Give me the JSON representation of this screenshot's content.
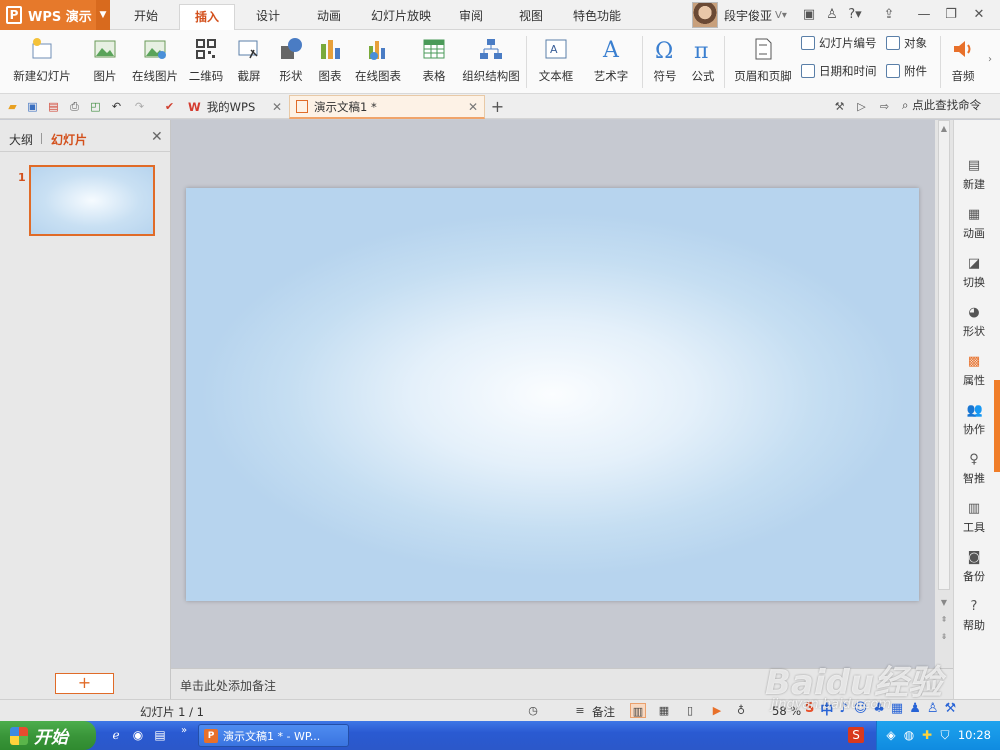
{
  "app": {
    "name": "WPS 演示"
  },
  "ribbon_tabs": [
    {
      "label": "开始"
    },
    {
      "label": "插入"
    },
    {
      "label": "设计"
    },
    {
      "label": "动画"
    },
    {
      "label": "幻灯片放映"
    },
    {
      "label": "审阅"
    },
    {
      "label": "视图"
    },
    {
      "label": "特色功能"
    }
  ],
  "active_tab": "插入",
  "user": {
    "name": "段宇俊亚"
  },
  "ribbon": {
    "new_slide": "新建幻灯片",
    "picture": "图片",
    "online_picture": "在线图片",
    "qrcode": "二维码",
    "screenshot": "截屏",
    "shape": "形状",
    "chart": "图表",
    "online_chart": "在线图表",
    "table": "表格",
    "org_chart": "组织结构图",
    "textbox": "文本框",
    "wordart": "艺术字",
    "symbol": "符号",
    "formula": "公式",
    "header_footer": "页眉和页脚",
    "slide_number": "幻灯片编号",
    "object": "对象",
    "date_time": "日期和时间",
    "attachment": "附件",
    "audio": "音频"
  },
  "doc_tabs": [
    {
      "label": "我的WPS"
    },
    {
      "label": "演示文稿1 *"
    }
  ],
  "command_search": "点此查找命令",
  "left_panel": {
    "tab_outline": "大纲",
    "tab_slides": "幻灯片",
    "slide_number": "1",
    "add_label": "+"
  },
  "notes_placeholder": "单击此处添加备注",
  "right_sidebar": [
    {
      "label": "新建"
    },
    {
      "label": "动画"
    },
    {
      "label": "切换"
    },
    {
      "label": "形状"
    },
    {
      "label": "属性"
    },
    {
      "label": "协作"
    },
    {
      "label": "智推"
    },
    {
      "label": "工具"
    },
    {
      "label": "备份"
    },
    {
      "label": "帮助"
    }
  ],
  "status": {
    "slide_counter": "幻灯片 1 / 1",
    "notes_label": "备注",
    "zoom": "58 %"
  },
  "taskbar": {
    "start_label": "开始",
    "task_label": "演示文稿1 * - WP...",
    "clock": "10:28"
  },
  "watermark": {
    "main": "Baidu经验",
    "sub": "jingyan.baidu.com"
  },
  "ime": {
    "label": "中"
  },
  "colors": {
    "accent": "#e06b28",
    "slide_bg": "#b7d4ee",
    "taskbar": "#2a5ad2"
  }
}
